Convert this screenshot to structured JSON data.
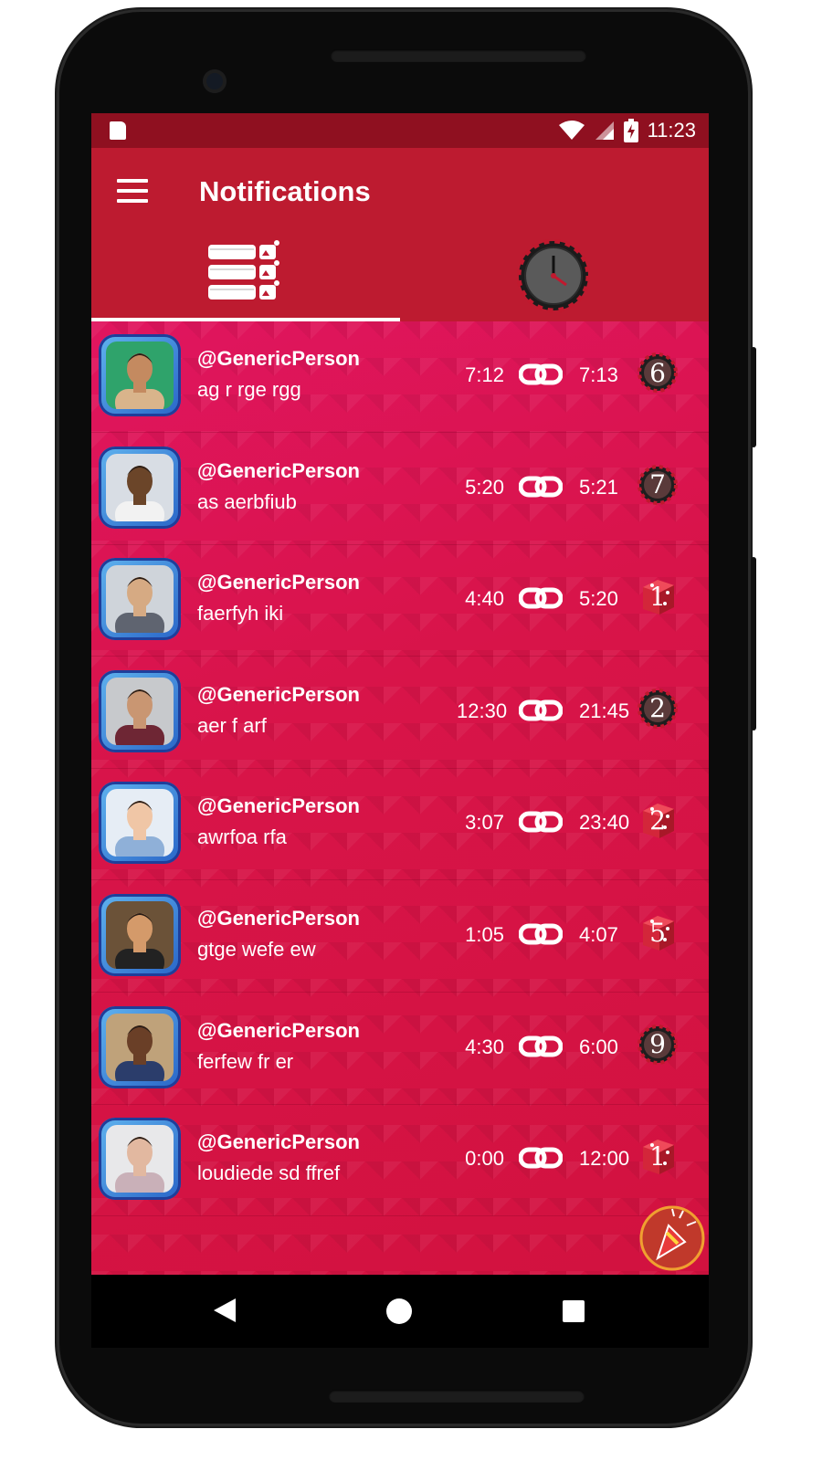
{
  "status_bar": {
    "time": "11:23"
  },
  "app_bar": {
    "title": "Notifications"
  },
  "tabs": [
    {
      "icon": "list-icon",
      "selected": true
    },
    {
      "icon": "clock-icon",
      "selected": false
    }
  ],
  "notifications": [
    {
      "username": "@GenericPerson",
      "message": "ag r rge rgg",
      "start": "7:12",
      "end": "7:13",
      "badge": "6",
      "badge_type": "roulette",
      "avatar_bg": "#2fa36b",
      "avatar_skin": "#c48a60",
      "avatar_shirt": "#d9b48b"
    },
    {
      "username": "@GenericPerson",
      "message": "as aerbfiub",
      "start": "5:20",
      "end": "5:21",
      "badge": "7",
      "badge_type": "roulette",
      "avatar_bg": "#d8dde4",
      "avatar_skin": "#6b4529",
      "avatar_shirt": "#f2f2f2"
    },
    {
      "username": "@GenericPerson",
      "message": "faerfyh  iki",
      "start": "4:40",
      "end": "5:20",
      "badge": "1",
      "badge_type": "dice",
      "avatar_bg": "#cfd4da",
      "avatar_skin": "#d6aa83",
      "avatar_shirt": "#5f6470"
    },
    {
      "username": "@GenericPerson",
      "message": "aer f arf",
      "start": "12:30",
      "end": "21:45",
      "badge": "2",
      "badge_type": "roulette",
      "avatar_bg": "#c7c9cc",
      "avatar_skin": "#c99672",
      "avatar_shirt": "#6e2634"
    },
    {
      "username": "@GenericPerson",
      "message": "awrfoa rfa",
      "start": "3:07",
      "end": "23:40",
      "badge": "2",
      "badge_type": "dice",
      "avatar_bg": "#e6edf5",
      "avatar_skin": "#f0c6a6",
      "avatar_shirt": "#8fb0d8"
    },
    {
      "username": "@GenericPerson",
      "message": "gtge  wefe ew",
      "start": "1:05",
      "end": "4:07",
      "badge": "5",
      "badge_type": "dice",
      "avatar_bg": "#6b5238",
      "avatar_skin": "#d49a6a",
      "avatar_shirt": "#222222"
    },
    {
      "username": "@GenericPerson",
      "message": "ferfew fr er",
      "start": "4:30",
      "end": "6:00",
      "badge": "9",
      "badge_type": "roulette",
      "avatar_bg": "#bfa27a",
      "avatar_skin": "#6a3f27",
      "avatar_shirt": "#2b3d6b"
    },
    {
      "username": "@GenericPerson",
      "message": "loudiede sd ffref",
      "start": "0:00",
      "end": "12:00",
      "badge": "1",
      "badge_type": "dice",
      "avatar_bg": "#e8e8ea",
      "avatar_skin": "#e2b8a0",
      "avatar_shirt": "#c9b0b8"
    }
  ],
  "colors": {
    "status_bar": "#8f1020",
    "app_bar": "#bd1b30",
    "list_background": "#d81449"
  }
}
